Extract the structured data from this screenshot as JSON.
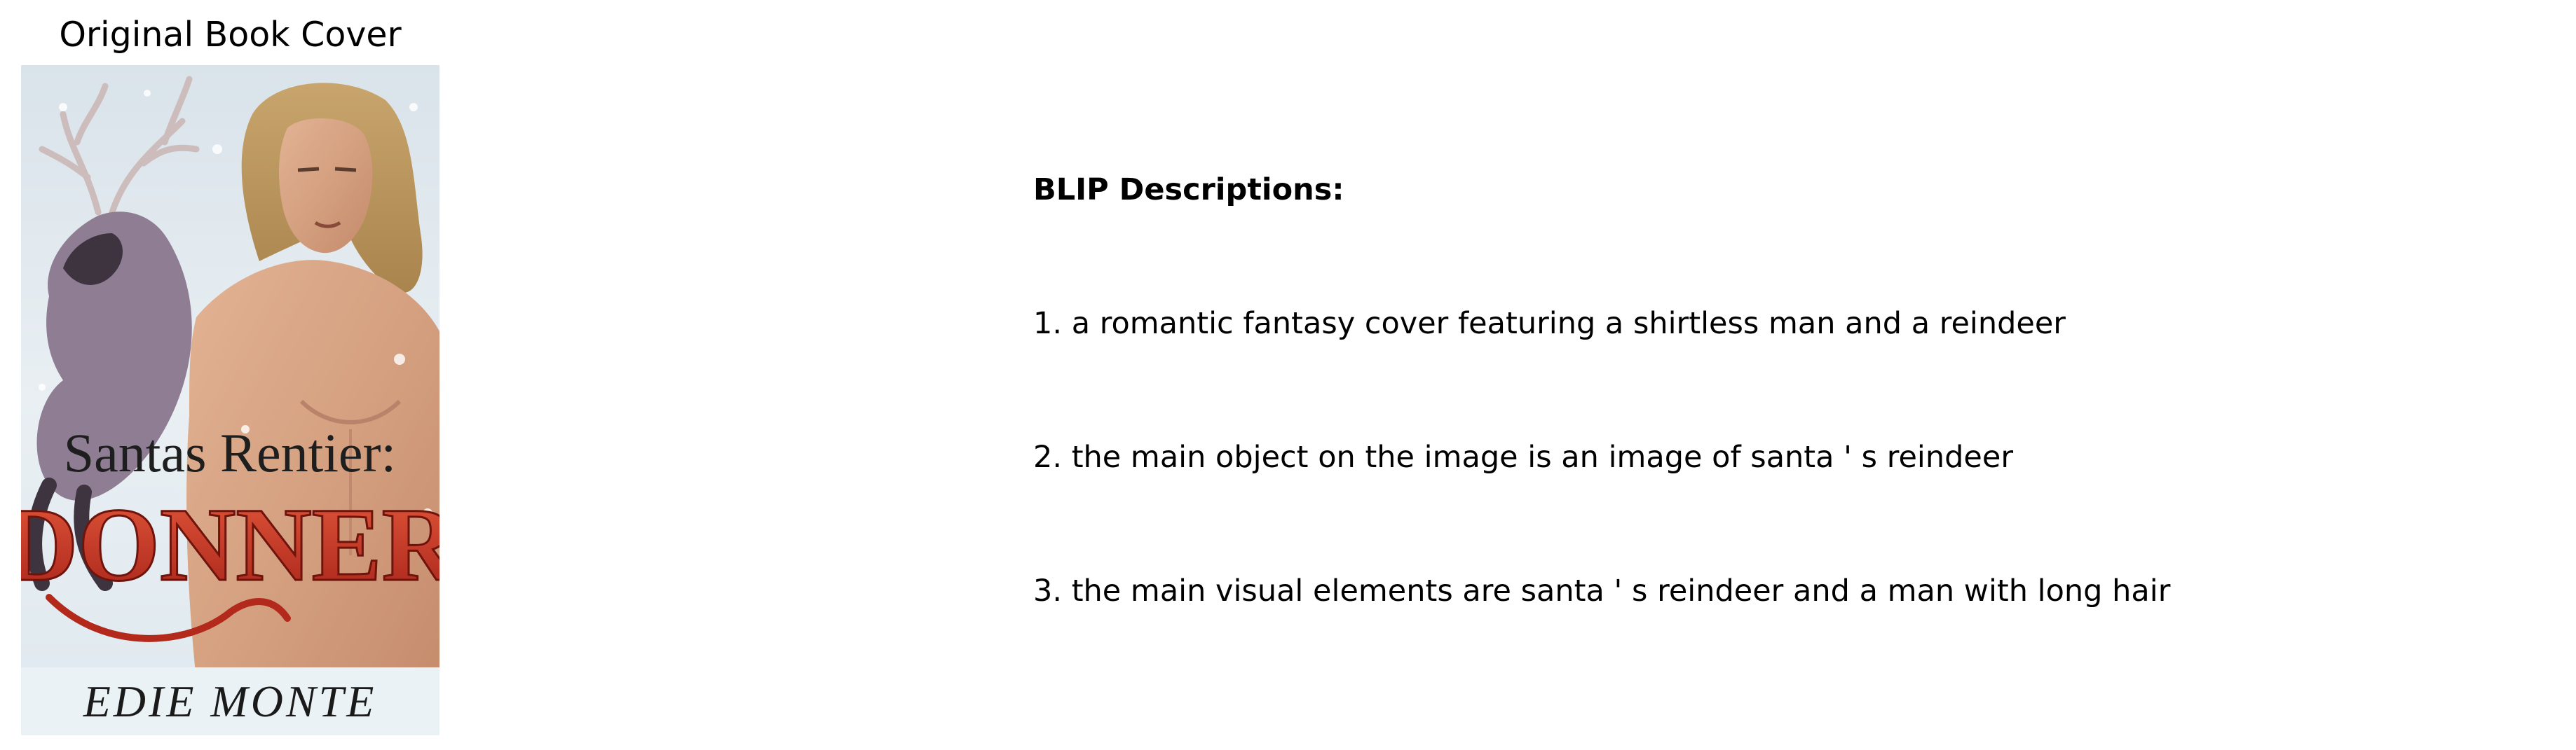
{
  "cover": {
    "heading": "Original Book Cover",
    "subtitle": "Santas Rentier:",
    "title": "DONNER",
    "author": "EDIE MONTE"
  },
  "descriptions": {
    "header": "BLIP Descriptions:",
    "items": [
      "1. a romantic fantasy cover featuring a shirtless man and a reindeer",
      "2. the main object on the image is an image of santa ' s reindeer",
      "3. the main visual elements are santa ' s reindeer and a man with long hair"
    ]
  },
  "colors": {
    "background": "#ffffff",
    "text": "#000000",
    "cover_title_red": "#c0341d",
    "cover_snow": "#e6eef3"
  }
}
